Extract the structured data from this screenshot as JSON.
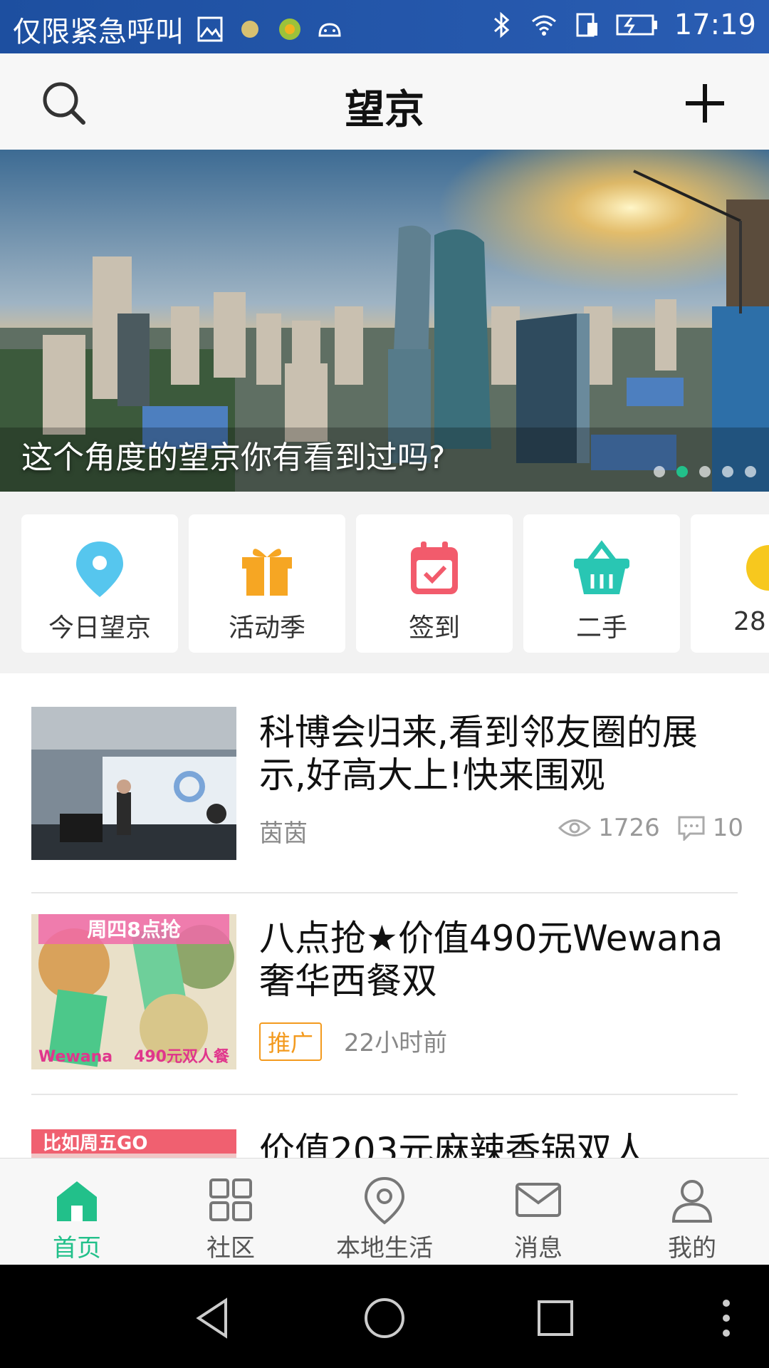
{
  "status_bar": {
    "left_text": "仅限紧急呼叫",
    "time": "17:19"
  },
  "header": {
    "title": "望京"
  },
  "banner": {
    "caption": "这个角度的望京你有看到过吗?",
    "active_dot": 2,
    "dots_count": 5
  },
  "shortcuts": [
    {
      "label": "今日望京",
      "icon": "location-pin-icon"
    },
    {
      "label": "活动季",
      "icon": "gift-icon"
    },
    {
      "label": "签到",
      "icon": "calendar-check-icon"
    },
    {
      "label": "二手",
      "icon": "basket-icon"
    },
    {
      "label": "28",
      "icon": "sun-icon"
    }
  ],
  "feed": [
    {
      "title": "科博会归来,看到邻友圈的展示,好高大上!快来围观",
      "author": "茵茵",
      "views": "1726",
      "comments": "10"
    },
    {
      "title": "八点抢★价值490元Wewana奢华西餐双",
      "badge": "推广",
      "time": "22小时前",
      "thumb_text_top": "周四8点抢",
      "thumb_text_left": "Wewana",
      "thumb_text_right": "490元双人餐"
    },
    {
      "title": "价值203元麻辣香锅双人",
      "thumb_text": "比如周五GO"
    }
  ],
  "tabs": [
    {
      "label": "首页",
      "active": true
    },
    {
      "label": "社区"
    },
    {
      "label": "本地生活"
    },
    {
      "label": "消息"
    },
    {
      "label": "我的"
    }
  ],
  "colors": {
    "accent": "#22c08a",
    "status_bar": "#1d4fa0",
    "promo_badge": "#f39a1e"
  }
}
